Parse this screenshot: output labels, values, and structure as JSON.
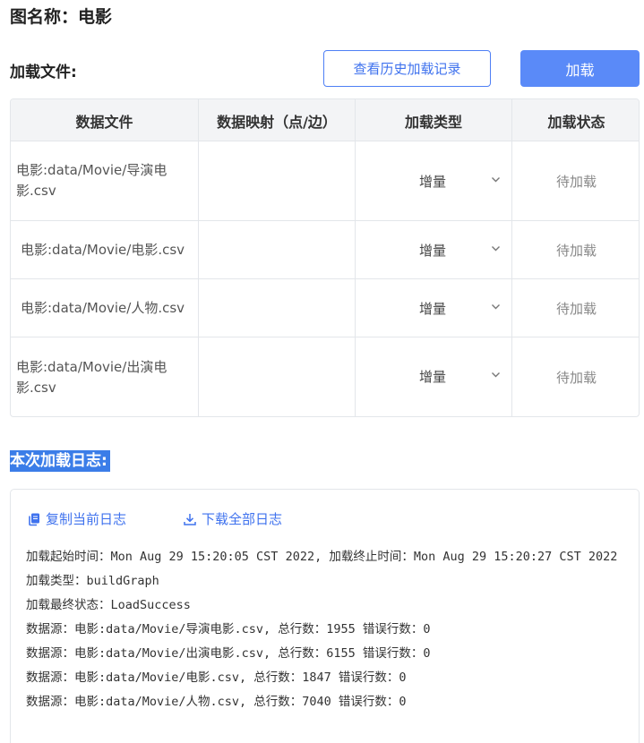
{
  "header": {
    "graph_title": "图名称：电影",
    "load_files_label": "加载文件:",
    "history_button": "查看历史加载记录",
    "load_button": "加载"
  },
  "table": {
    "columns": [
      "数据文件",
      "数据映射（点/边）",
      "加载类型",
      "加载状态"
    ],
    "rows": [
      {
        "file": "电影:data/Movie/导演电影.csv",
        "mapping": "",
        "type": "增量",
        "status": "待加载"
      },
      {
        "file": "电影:data/Movie/电影.csv",
        "mapping": "",
        "type": "增量",
        "status": "待加载"
      },
      {
        "file": "电影:data/Movie/人物.csv",
        "mapping": "",
        "type": "增量",
        "status": "待加载"
      },
      {
        "file": "电影:data/Movie/出演电影.csv",
        "mapping": "",
        "type": "增量",
        "status": "待加载"
      }
    ]
  },
  "log": {
    "title": "本次加载日志:",
    "copy_label": "复制当前日志",
    "download_label": "下载全部日志",
    "lines": [
      "加载起始时间：Mon Aug 29 15:20:05 CST 2022, 加载终止时间：Mon Aug 29 15:20:27 CST 2022",
      "加载类型：buildGraph",
      "加载最终状态：LoadSuccess",
      "数据源：电影:data/Movie/导演电影.csv, 总行数：1955 错误行数：0",
      "数据源：电影:data/Movie/出演电影.csv, 总行数：6155 错误行数：0",
      "数据源：电影:data/Movie/电影.csv, 总行数：1847 错误行数：0",
      "数据源：电影:data/Movie/人物.csv, 总行数：7040 错误行数：0"
    ]
  },
  "colors": {
    "accent": "#5a8af8",
    "link": "#3f72ee",
    "highlight": "#3b7de8",
    "border": "#e3e6ea",
    "header_bg": "#f3f4f6"
  },
  "icons": {
    "copy": "copy-icon",
    "download": "download-icon",
    "select_arrow": "chevron-down-icon"
  }
}
